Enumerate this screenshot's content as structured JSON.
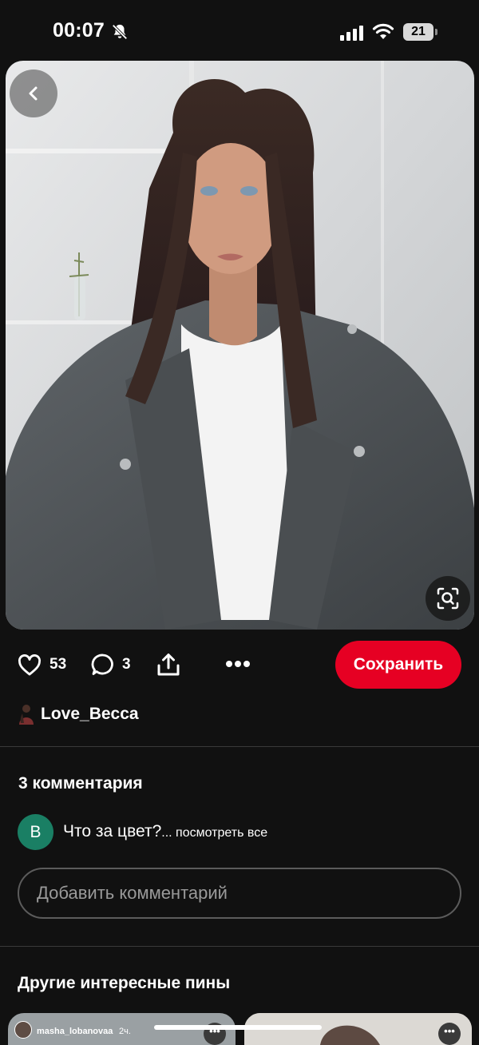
{
  "status_bar": {
    "time": "00:07",
    "battery_level": "21",
    "icons": [
      "bell-muted-icon",
      "signal-icon",
      "wifi-icon",
      "battery-icon"
    ]
  },
  "pin": {
    "image_description": "",
    "back_icon": "chevron-left-icon",
    "visual_search_icon": "lens-search-icon"
  },
  "actions": {
    "likes": "53",
    "comments": "3",
    "save_label": "Сохранить",
    "icons": [
      "heart-icon",
      "comment-bubble-icon",
      "share-icon",
      "more-icon"
    ]
  },
  "author": {
    "name": "Love_Becca"
  },
  "comments": {
    "title": "3 комментария",
    "first": {
      "avatar_letter": "B",
      "text": "Что за цвет?",
      "ellipsis": "...",
      "see_all": " посмотреть все"
    },
    "input_placeholder": "Добавить комментарий"
  },
  "more_pins": {
    "title": "Другие интересные пины",
    "cards": [
      {
        "username": "masha_lobanovaa",
        "time": "2ч.",
        "more": "•••"
      },
      {
        "more": "•••"
      }
    ]
  },
  "colors": {
    "background": "#111111",
    "save_button": "#e60023",
    "comment_avatar": "#1a7f64"
  }
}
